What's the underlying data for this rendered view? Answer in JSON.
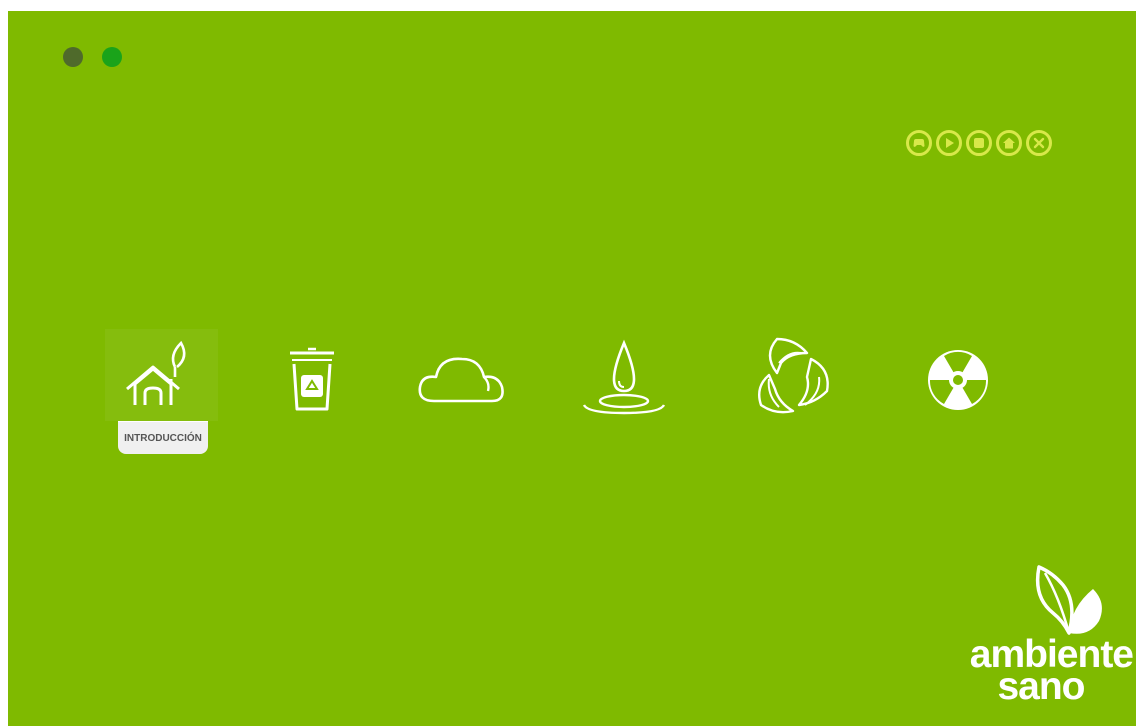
{
  "colors": {
    "background": "#7fba00",
    "controls": "#d8e84a",
    "icon_stroke": "#ffffff"
  },
  "window_dots": [
    {
      "name": "dot-dark",
      "color": "#4f6a2b"
    },
    {
      "name": "dot-green",
      "color": "#1aa31a"
    }
  ],
  "controls": [
    {
      "icon": "gamepad-icon"
    },
    {
      "icon": "play-icon"
    },
    {
      "icon": "stop-icon"
    },
    {
      "icon": "home-icon"
    },
    {
      "icon": "close-icon"
    }
  ],
  "menu": {
    "items": [
      {
        "icon": "house-leaf-icon",
        "label": "INTRODUCCIÓN",
        "active": true
      },
      {
        "icon": "recycle-bin-icon"
      },
      {
        "icon": "cloud-icon"
      },
      {
        "icon": "water-drop-icon"
      },
      {
        "icon": "recycle-leaves-icon"
      },
      {
        "icon": "radiation-icon"
      }
    ]
  },
  "logo": {
    "line1": "ambiente",
    "line2": "sano"
  }
}
